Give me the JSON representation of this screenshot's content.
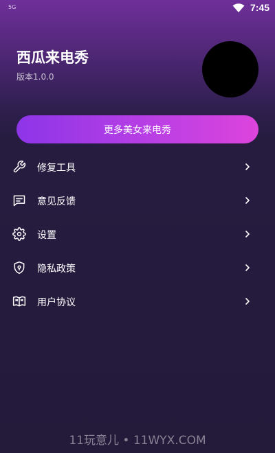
{
  "status_bar": {
    "network": "5G",
    "time": "7:45",
    "wifi_icon": "wifi-icon"
  },
  "header": {
    "app_name": "西瓜来电秀",
    "version": "版本1.0.0",
    "avatar_color": "#000000"
  },
  "promo_button": {
    "label": "更多美女来电秀",
    "gradient": [
      "#8d35e8",
      "#dd44dc"
    ]
  },
  "menu": {
    "items": [
      {
        "label": "修复工具",
        "icon": "wrench-icon"
      },
      {
        "label": "意见反馈",
        "icon": "feedback-icon"
      },
      {
        "label": "设置",
        "icon": "gear-icon"
      },
      {
        "label": "隐私政策",
        "icon": "shield-icon"
      },
      {
        "label": "用户协议",
        "icon": "book-icon"
      }
    ],
    "chevron_icon": "chevron-right-icon"
  },
  "watermark": "11玩意儿 • 11WYX.COM",
  "colors": {
    "background": "#241a3a",
    "header_top": "#6f2f9a",
    "text": "#ffffff"
  }
}
